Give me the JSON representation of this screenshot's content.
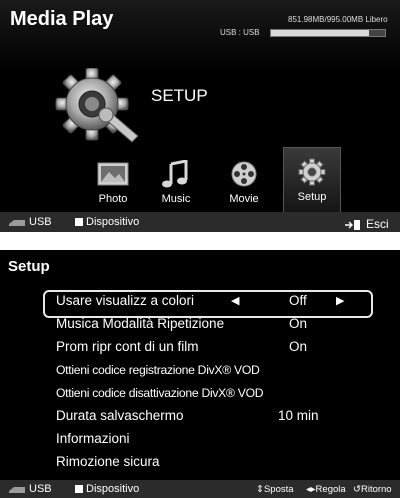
{
  "top": {
    "title": "Media Play",
    "usb_label": "USB : USB",
    "storage_text": "851.98MB/995.00MB Libero",
    "storage_used_fraction": 0.856,
    "heading": "SETUP",
    "apps": [
      {
        "label": "Photo",
        "icon": "photo-icon"
      },
      {
        "label": "Music",
        "icon": "music-note-icon"
      },
      {
        "label": "Movie",
        "icon": "film-reel-icon"
      },
      {
        "label": "Setup",
        "icon": "gear-icon"
      }
    ],
    "footer": {
      "usb": "USB",
      "device": "Dispositivo",
      "exit": "Esci"
    }
  },
  "bottom": {
    "title": "Setup",
    "items": [
      {
        "label": "Usare visualizz a colori",
        "value": "Off",
        "selected": true
      },
      {
        "label": "Musica Modalità Ripetizione",
        "value": "On"
      },
      {
        "label": "Prom ripr cont di un film",
        "value": "On"
      },
      {
        "label": "Ottieni codice registrazione DivX® VOD",
        "value": ""
      },
      {
        "label": "Ottieni codice disattivazione DivX® VOD",
        "value": ""
      },
      {
        "label": "Durata salvaschermo",
        "value": "10 min"
      },
      {
        "label": "Informazioni",
        "value": ""
      },
      {
        "label": "Rimozione sicura",
        "value": ""
      }
    ],
    "footer": {
      "usb": "USB",
      "device": "Dispositivo",
      "move": "Sposta",
      "adjust": "Regola",
      "back": "Ritorno"
    }
  },
  "colors": {
    "background": "#000000",
    "footer_bar": "#2b2b2b",
    "text": "#ffffff",
    "highlight_border": "#e8e8e8"
  }
}
